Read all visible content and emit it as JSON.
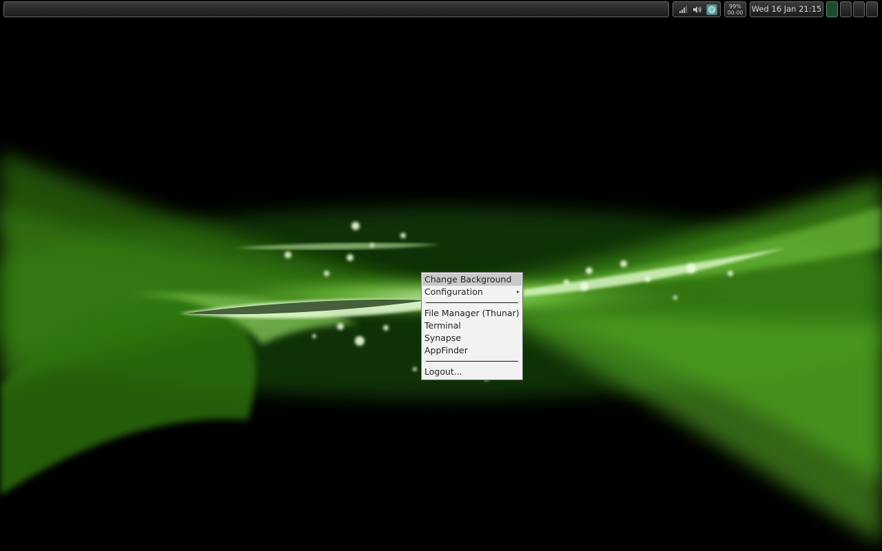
{
  "panel": {
    "battery": {
      "percent": "99%",
      "time": "00:00"
    },
    "clock": "Wed 16 Jan 21:15",
    "workspaces": [
      {
        "active": true
      },
      {
        "active": false
      },
      {
        "active": false
      },
      {
        "active": false
      }
    ],
    "tray_icons": [
      "network-signal-icon",
      "volume-icon",
      "app-indicator-icon"
    ]
  },
  "context_menu": {
    "items": [
      {
        "label": "Change Background"
      },
      {
        "label": "Configuration",
        "submenu": true,
        "arrow": "▸"
      },
      {
        "label": "File Manager (Thunar)"
      },
      {
        "label": "Terminal"
      },
      {
        "label": "Synapse"
      },
      {
        "label": "AppFinder"
      },
      {
        "label": "Logout..."
      }
    ]
  },
  "colors": {
    "accent_green": "#6fcf3a",
    "active_workspace": "#1f4a2c",
    "menu_background": "#f2f2f2",
    "menu_highlight": "#c9c9c9"
  }
}
